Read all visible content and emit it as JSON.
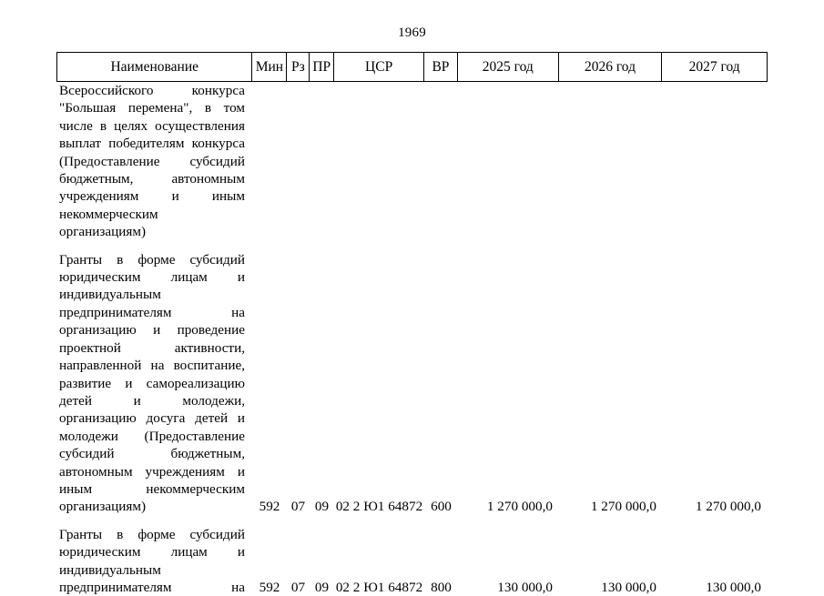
{
  "page": {
    "number": "1969"
  },
  "table": {
    "headers": {
      "name": "Наименование",
      "min": "Мин",
      "rz": "Рз",
      "pr": "ПР",
      "csr": "ЦСР",
      "vr": "ВР",
      "year1": "2025 год",
      "year2": "2026 год",
      "year3": "2027 год"
    },
    "rows": [
      {
        "name_lines": [
          "Всероссийского конкурса",
          "\"Большая перемена\", в том",
          "числе в целях осуществления",
          "выплат победителям конкурса",
          "(Предоставление субсидий",
          "бюджетным, автономным",
          "учреждениям и иным",
          "некоммерческим",
          "организациям)"
        ],
        "min": "",
        "rz": "",
        "pr": "",
        "csr": "",
        "vr": "",
        "year1": "",
        "year2": "",
        "year3": ""
      },
      {
        "name_lines": [
          "Гранты в форме субсидий",
          "юридическим лицам и",
          "индивидуальным",
          "предпринимателям на",
          "организацию и проведение",
          "проектной активности,",
          "направленной на воспитание,",
          "развитие и самореализацию",
          "детей и молодежи,",
          "организацию досуга детей и",
          "молодежи (Предоставление",
          "субсидий бюджетным,",
          "автономным учреждениям и",
          "иным некоммерческим",
          "организациям)"
        ],
        "min": "592",
        "rz": "07",
        "pr": "09",
        "csr": "02 2 Ю1 64872",
        "vr": "600",
        "year1": "1 270 000,0",
        "year2": "1 270 000,0",
        "year3": "1 270 000,0"
      },
      {
        "name_lines": [
          "Гранты в форме субсидий",
          "юридическим лицам и",
          "индивидуальным",
          "предпринимателям на"
        ],
        "min": "592",
        "rz": "07",
        "pr": "09",
        "csr": "02 2 Ю1 64872",
        "vr": "800",
        "year1": "130 000,0",
        "year2": "130 000,0",
        "year3": "130 000,0"
      }
    ]
  }
}
